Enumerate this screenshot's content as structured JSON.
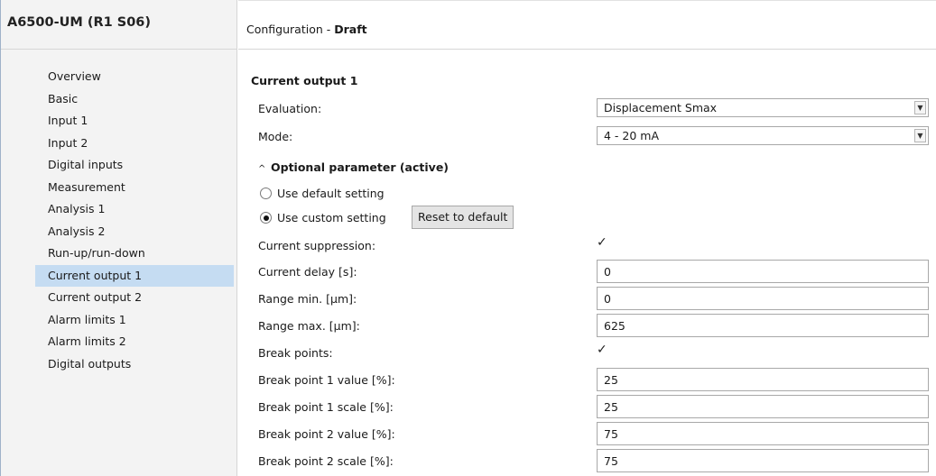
{
  "sidebar": {
    "title": "A6500-UM (R1 S06)",
    "items": [
      {
        "label": "Overview"
      },
      {
        "label": "Basic"
      },
      {
        "label": "Input 1"
      },
      {
        "label": "Input 2"
      },
      {
        "label": "Digital inputs"
      },
      {
        "label": "Measurement"
      },
      {
        "label": "Analysis 1"
      },
      {
        "label": "Analysis 2"
      },
      {
        "label": "Run-up/run-down"
      },
      {
        "label": "Current output 1"
      },
      {
        "label": "Current output 2"
      },
      {
        "label": "Alarm limits 1"
      },
      {
        "label": "Alarm limits 2"
      },
      {
        "label": "Digital outputs"
      }
    ],
    "active_index": 9
  },
  "header": {
    "title": "Configuration",
    "separator": " - ",
    "status": "Draft"
  },
  "form": {
    "section_title": "Current output 1",
    "evaluation": {
      "label": "Evaluation:",
      "value": "Displacement Smax"
    },
    "mode": {
      "label": "Mode:",
      "value": "4 - 20 mA"
    },
    "optional": {
      "caret": "^",
      "label": "Optional parameter (active)"
    },
    "radio_default": {
      "label": "Use default setting",
      "checked": false
    },
    "radio_custom": {
      "label": "Use custom setting",
      "checked": true
    },
    "reset_button": "Reset to default",
    "current_suppression": {
      "label": "Current suppression:",
      "checked": true
    },
    "current_delay": {
      "label": "Current delay [s]:",
      "value": "0"
    },
    "range_min": {
      "label": "Range min. [µm]:",
      "value": "0"
    },
    "range_max": {
      "label": "Range max. [µm]:",
      "value": "625"
    },
    "break_points": {
      "label": "Break points:",
      "checked": true
    },
    "bp1_value": {
      "label": "Break point 1 value [%]:",
      "value": "25"
    },
    "bp1_scale": {
      "label": "Break point 1 scale [%]:",
      "value": "25"
    },
    "bp2_value": {
      "label": "Break point 2 value [%]:",
      "value": "75"
    },
    "bp2_scale": {
      "label": "Break point 2 scale [%]:",
      "value": "75"
    }
  },
  "icons": {
    "checkmark": "✓",
    "dropdown": "chevron-down-icon"
  }
}
